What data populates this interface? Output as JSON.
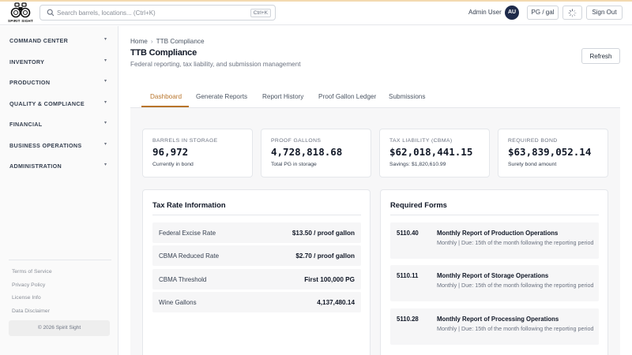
{
  "brand": {
    "name": "SPIRIT SIGHT"
  },
  "search": {
    "placeholder": "Search barrels, locations... (Ctrl+K)",
    "shortcut": "Ctrl+K"
  },
  "header": {
    "user_name": "Admin User",
    "avatar_initials": "AU",
    "unit_toggle": "PG / gal",
    "signout_label": "Sign Out"
  },
  "sidebar": {
    "items": [
      {
        "label": "COMMAND CENTER"
      },
      {
        "label": "INVENTORY"
      },
      {
        "label": "PRODUCTION"
      },
      {
        "label": "QUALITY & COMPLIANCE"
      },
      {
        "label": "FINANCIAL"
      },
      {
        "label": "BUSINESS OPERATIONS"
      },
      {
        "label": "ADMINISTRATION"
      }
    ],
    "caret": "▾",
    "footer_links": [
      "Terms of Service",
      "Privacy Policy",
      "License Info",
      "Data Disclaimer"
    ],
    "copyright": "© 2026 Spirit Sight"
  },
  "page": {
    "breadcrumb": [
      "Home",
      "TTB Compliance"
    ],
    "breadcrumb_sep": "›",
    "title": "TTB Compliance",
    "subtitle": "Federal reporting, tax liability, and submission management",
    "refresh_label": "Refresh"
  },
  "tabs": [
    {
      "label": "Dashboard",
      "active": true
    },
    {
      "label": "Generate Reports"
    },
    {
      "label": "Report History"
    },
    {
      "label": "Proof Gallon Ledger"
    },
    {
      "label": "Submissions"
    }
  ],
  "stats": [
    {
      "label": "Barrels in Storage",
      "value": "96,972",
      "sub": "Currently in bond"
    },
    {
      "label": "Proof Gallons",
      "value": "4,728,818.68",
      "sub": "Total PG in storage"
    },
    {
      "label": "Tax Liability (CBMA)",
      "value": "$62,018,441.15",
      "sub": "Savings: $1,820,610.99"
    },
    {
      "label": "Required Bond",
      "value": "$63,839,052.14",
      "sub": "Surety bond amount"
    }
  ],
  "tax_rates": {
    "title": "Tax Rate Information",
    "rows": [
      {
        "label": "Federal Excise Rate",
        "value": "$13.50 / proof gallon"
      },
      {
        "label": "CBMA Reduced Rate",
        "value": "$2.70 / proof gallon"
      },
      {
        "label": "CBMA Threshold",
        "value": "First 100,000 PG"
      },
      {
        "label": "Wine Gallons",
        "value": "4,137,480.14"
      }
    ]
  },
  "required_forms": {
    "title": "Required Forms",
    "rows": [
      {
        "code": "5110.40",
        "title": "Monthly Report of Production Operations",
        "desc": "Monthly | Due: 15th of the month following the reporting period"
      },
      {
        "code": "5110.11",
        "title": "Monthly Report of Storage Operations",
        "desc": "Monthly | Due: 15th of the month following the reporting period"
      },
      {
        "code": "5110.28",
        "title": "Monthly Report of Processing Operations",
        "desc": "Monthly | Due: 15th of the month following the reporting period"
      }
    ]
  },
  "colors": {
    "accent": "#b8742a",
    "avatar": "#1e2a4a",
    "topbar_accent": "#f3d9b0"
  }
}
